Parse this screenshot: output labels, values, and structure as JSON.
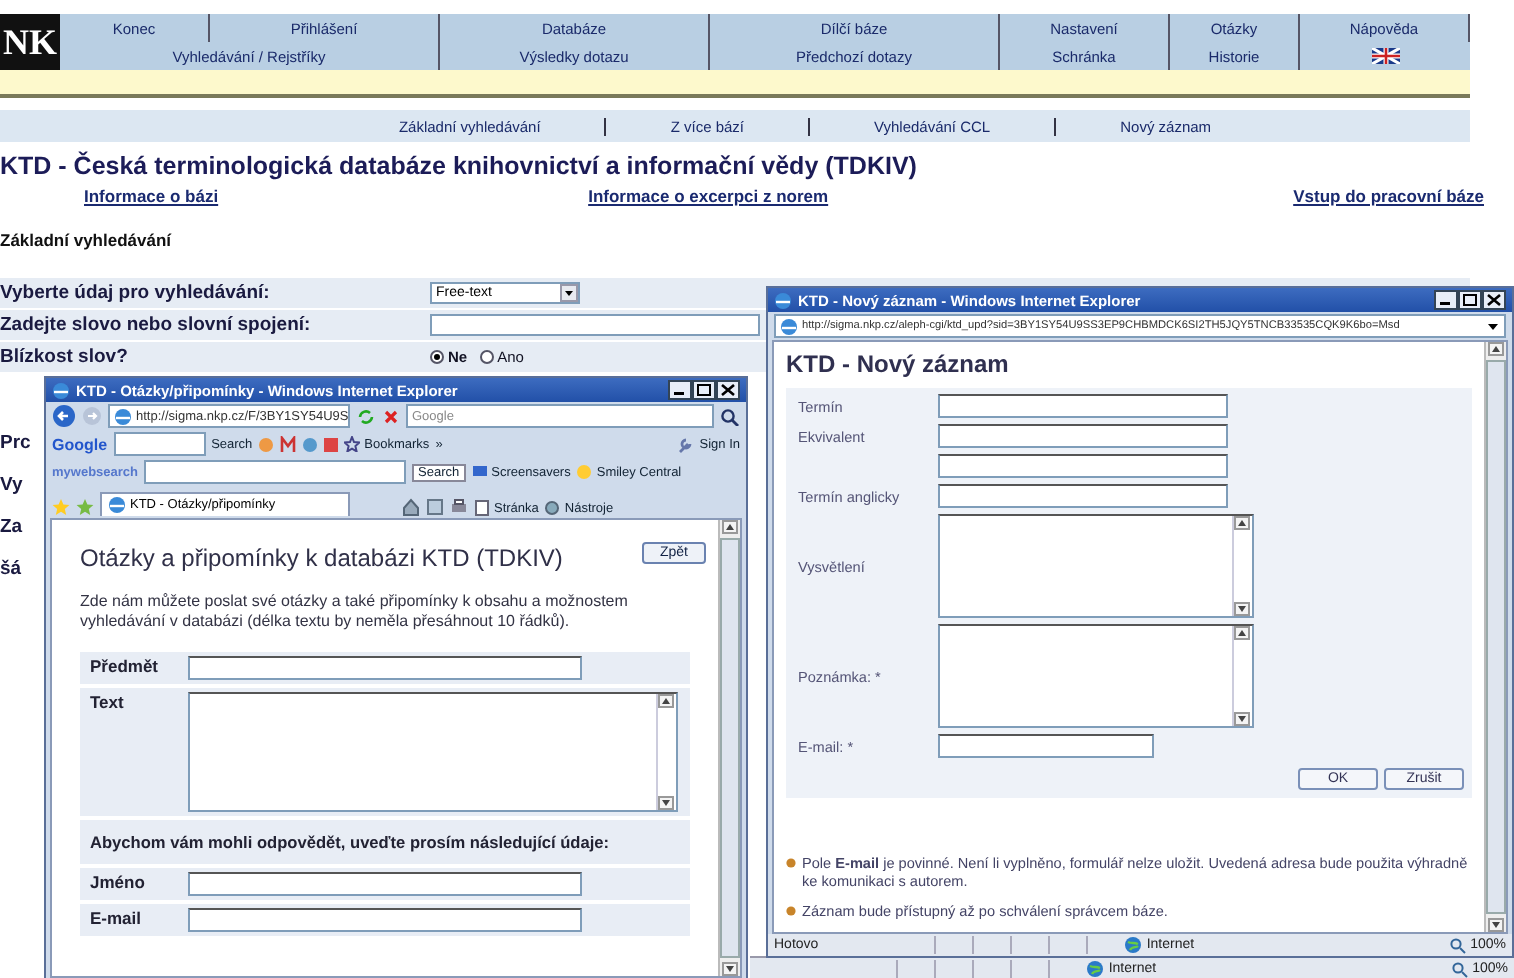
{
  "site": {
    "logo": "NK",
    "nav_top": [
      "Konec",
      "Přihlášení",
      "Databáze",
      "Dílčí báze",
      "Nastavení",
      "Otázky",
      "Nápověda"
    ],
    "nav_bottom": [
      "Vyhledávání / Rejstříky",
      "Výsledky dotazu",
      "Předchozí dotazy",
      "Schránka",
      "Historie"
    ],
    "subnav": [
      "Základní vyhledávání",
      "Z více bází",
      "Vyhledávání CCL",
      "Nový záznam"
    ],
    "title": "KTD - Česká terminologická databáze knihovnictví a informační vědy (TDKIV)",
    "links": [
      "Informace o bázi",
      "Informace o excerpci z norem",
      "Vstup do pracovní báze"
    ],
    "section": "Základní vyhledávání",
    "search_form": {
      "field_label": "Vyberte údaj pro vyhledávání:",
      "field_value": "Free-text",
      "query_label": "Zadejte slovo nebo slovní spojení:",
      "proximity_label": "Blízkost slov?",
      "proximity_options": [
        {
          "label": "Ne",
          "selected": true
        },
        {
          "label": "Ano",
          "selected": false
        }
      ]
    },
    "cut_fragments": [
      "Prc",
      "Vy",
      "Za",
      "šá"
    ]
  },
  "feedback_window": {
    "title": "KTD - Otázky/připomínky - Windows Internet Explorer",
    "address": "http://sigma.nkp.cz/F/3BY1SY54U9S",
    "search_placeholder": "Google",
    "google_toolbar": {
      "logo": "Google",
      "search": "Search",
      "bookmarks": "Bookmarks",
      "more": "»",
      "sign_in": "Sign In"
    },
    "web_toolbar": {
      "logo": "mywebsearch",
      "search": "Search",
      "items": [
        "Screensavers",
        "Smiley Central"
      ]
    },
    "tab": "KTD - Otázky/připomínky",
    "commands": [
      "Stránka",
      "Nástroje"
    ],
    "heading": "Otázky a připomínky k databázi KTD (TDKIV)",
    "back_button": "Zpět",
    "intro": "Zde nám můžete poslat své otázky a také připomínky k obsahu a možnostem vyhledávání v databázi (délka textu by neměla přesáhnout 10 řádků).",
    "fields": [
      {
        "kind": "input",
        "label": "Předmět"
      },
      {
        "kind": "textarea",
        "label": "Text"
      },
      {
        "kind": "section",
        "label": "Abychom vám mohli odpovědět, uveďte prosím následující údaje:"
      },
      {
        "kind": "input",
        "label": "Jméno"
      },
      {
        "kind": "input",
        "label": "E-mail"
      }
    ]
  },
  "record_window": {
    "title": "KTD - Nový záznam - Windows Internet Explorer",
    "address": "http://sigma.nkp.cz/aleph-cgi/ktd_upd?sid=3BY1SY54U9SS3EP9CHBMDCK6SI2TH5JQY5TNCB33535CQK9K6bo=Msd",
    "heading": "KTD - Nový záznam",
    "fields": [
      {
        "kind": "input",
        "label": "Termín"
      },
      {
        "kind": "input",
        "label": "Ekvivalent"
      },
      {
        "kind": "input"
      },
      {
        "kind": "input",
        "label": "Termín anglicky"
      },
      {
        "kind": "textarea",
        "label": "Vysvětlení"
      },
      {
        "kind": "textarea",
        "label": "Poznámka: *"
      },
      {
        "kind": "short",
        "label": "E-mail: *"
      }
    ],
    "buttons": [
      "OK",
      "Zrušit"
    ],
    "notes": [
      "Pole **E-mail** je povinné. Není li vyplněno, formulář nelze uložit. Uvedená adresa bude použita výhradně ke komunikaci s autorem.",
      "Záznam bude přístupný až po schválení správcem báze."
    ],
    "status": {
      "text": "Hotovo",
      "zone": "Internet",
      "zoom": "100%"
    }
  },
  "background_status": {
    "zone": "Internet",
    "zoom": "100%"
  }
}
